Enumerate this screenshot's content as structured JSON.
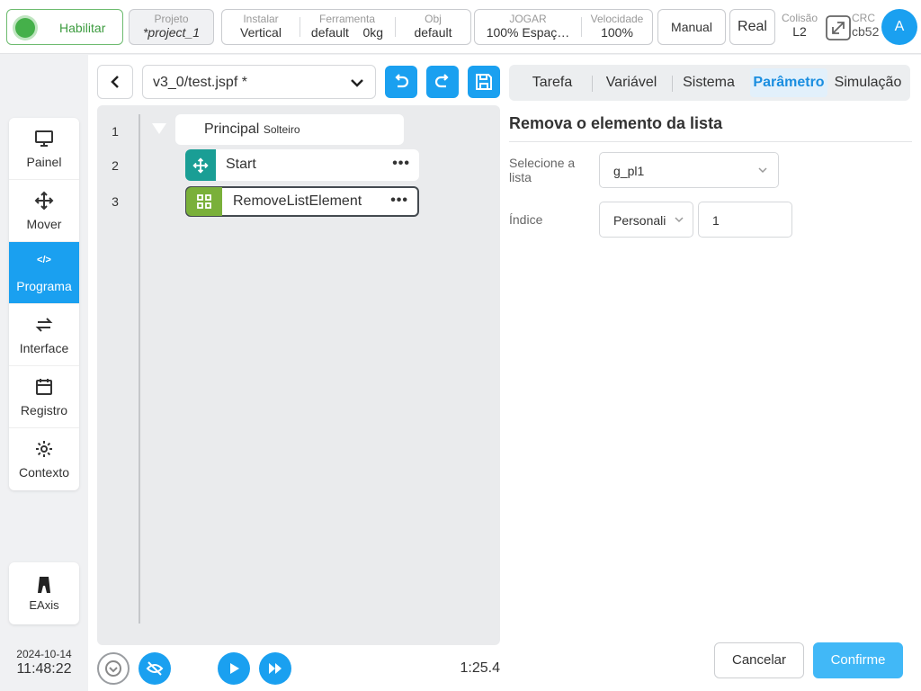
{
  "topbar": {
    "enable_label": "Habilitar",
    "project": {
      "title": "Projeto",
      "value": "*project_1"
    },
    "install": {
      "title": "Instalar",
      "value": "Vertical"
    },
    "tool": {
      "title": "Ferramenta",
      "value": "default",
      "weight": "0kg"
    },
    "obj": {
      "title": "Obj",
      "value": "default"
    },
    "jog": {
      "title": "JOGAR",
      "value": "100%  Espaç…"
    },
    "speed": {
      "title": "Velocidade",
      "value": "100%"
    },
    "manual_label": "Manual",
    "real_label": "Real",
    "collision": {
      "title": "Colisão",
      "value": "L2"
    },
    "crc": {
      "title": "CRC",
      "value": "cb52"
    },
    "avatar": "A"
  },
  "sidebar": {
    "items": [
      {
        "label": "Painel",
        "icon": "monitor-icon"
      },
      {
        "label": "Mover",
        "icon": "move-icon"
      },
      {
        "label": "Programa",
        "icon": "code-icon",
        "active": true
      },
      {
        "label": "Interface",
        "icon": "swap-icon"
      },
      {
        "label": "Registro",
        "icon": "calendar-icon"
      },
      {
        "label": "Contexto",
        "icon": "gear-icon"
      }
    ],
    "eaxis_label": "EAxis",
    "date": "2024-10-14",
    "time": "11:48:22"
  },
  "editor": {
    "file": "v3_0/test.jspf *",
    "tree": {
      "lines": [
        "1",
        "2",
        "3"
      ],
      "root_label": "Principal",
      "root_sub": "Solteiro",
      "nodes": [
        {
          "label": "Start",
          "icon": "move-icon",
          "color": "#1a9e95"
        },
        {
          "label": "RemoveListElement",
          "icon": "grid-icon",
          "color": "#7ab03a"
        }
      ]
    },
    "time": "1:25.4"
  },
  "tabs": [
    "Tarefa",
    "Variável",
    "Sistema",
    "Parâmetro",
    "Simulação"
  ],
  "panel": {
    "title": "Remova o elemento da lista",
    "list_label": "Selecione a lista",
    "list_value": "g_pl1",
    "index_label": "Índice",
    "index_mode": "Personali",
    "index_value": "1"
  },
  "buttons": {
    "cancel": "Cancelar",
    "confirm": "Confirme"
  },
  "colors": {
    "accent": "#1aa0f0",
    "enable": "#45b04a",
    "confirm": "#41b8f7"
  }
}
